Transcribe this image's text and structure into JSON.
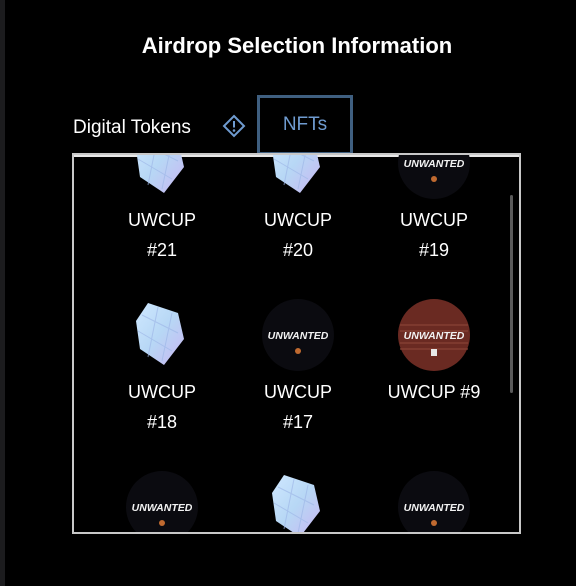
{
  "modal": {
    "title": "Airdrop Selection Information"
  },
  "tabs": {
    "digital_tokens": "Digital Tokens",
    "nfts": "NFTs",
    "active": "NFTs",
    "info_icon": "info-diamond-icon"
  },
  "nft_grid": {
    "items": [
      {
        "line1": "UWCUP",
        "line2": "#21",
        "art": "crystal"
      },
      {
        "line1": "UWCUP",
        "line2": "#20",
        "art": "crystal"
      },
      {
        "line1": "UWCUP",
        "line2": "#19",
        "art": "unwanted-dark"
      },
      {
        "line1": "UWCUP",
        "line2": "#18",
        "art": "crystal"
      },
      {
        "line1": "UWCUP",
        "line2": "#17",
        "art": "unwanted-dark"
      },
      {
        "line1": "UWCUP #9",
        "line2": "",
        "art": "unwanted-red"
      },
      {
        "line1": "",
        "line2": "",
        "art": "unwanted-dark"
      },
      {
        "line1": "",
        "line2": "",
        "art": "crystal"
      },
      {
        "line1": "",
        "line2": "",
        "art": "unwanted-dark"
      }
    ],
    "art_logo_text": "UNWANTED"
  },
  "colors": {
    "background": "#000000",
    "active_tab_border": "#3f5f80",
    "active_tab_text": "#6f9bd0",
    "info_icon": "#6f9bd0",
    "panel_border": "#c8c8c8"
  }
}
